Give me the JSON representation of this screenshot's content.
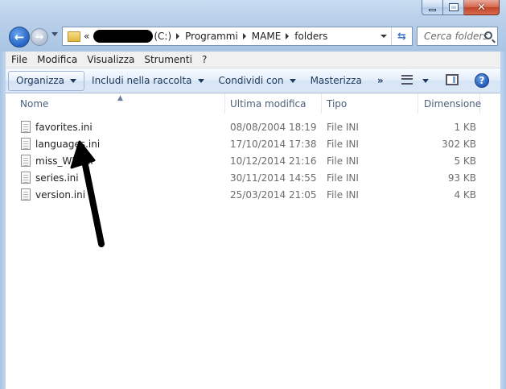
{
  "address": {
    "prefix": "«",
    "drive": "(C:)",
    "segments": [
      "Programmi",
      "MAME",
      "folders"
    ]
  },
  "search": {
    "placeholder": "Cerca folders"
  },
  "menu": [
    "File",
    "Modifica",
    "Visualizza",
    "Strumenti",
    "?"
  ],
  "commands": {
    "organize": "Organizza",
    "include": "Includi nella raccolta",
    "share": "Condividi con",
    "burn": "Masterizza",
    "more": "»"
  },
  "columns": {
    "name": "Nome",
    "modified": "Ultima modifica",
    "type": "Tipo",
    "size": "Dimensione"
  },
  "files": [
    {
      "name": "favorites.ini",
      "modified": "08/08/2004 18:19",
      "type": "File INI",
      "size": "1 KB"
    },
    {
      "name": "languages.ini",
      "modified": "17/10/2014 17:38",
      "type": "File INI",
      "size": "302 KB"
    },
    {
      "name": "miss_WB.ini",
      "modified": "10/12/2014 21:16",
      "type": "File INI",
      "size": "5 KB"
    },
    {
      "name": "series.ini",
      "modified": "30/11/2014 14:55",
      "type": "File INI",
      "size": "93 KB"
    },
    {
      "name": "version.ini",
      "modified": "25/03/2014 21:05",
      "type": "File INI",
      "size": "4 KB"
    }
  ],
  "colors": {
    "frame": "#b9d0ea",
    "command_bar": "#dbe7f6",
    "header_text": "#4c607a",
    "annotation": "#000000"
  }
}
